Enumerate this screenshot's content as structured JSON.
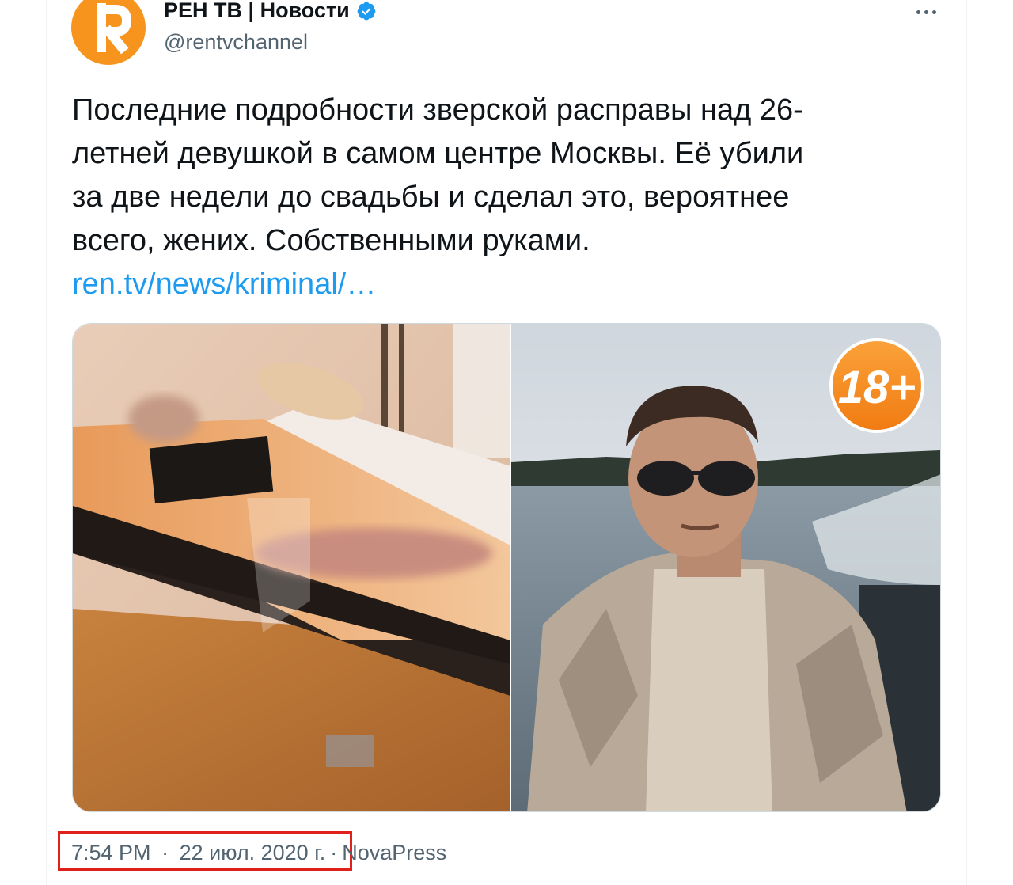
{
  "tweet": {
    "display_name": "РЕН ТВ | Новости",
    "handle": "@rentvchannel",
    "verified": true,
    "text_lines": [
      "Последние подробности зверской расправы над 26-",
      "летней девушкой в самом центре Москвы. Её убили",
      "за две недели до свадьбы и сделал это, вероятнее",
      "всего, жених. Собственными руками."
    ],
    "link_text": "ren.tv/news/kriminal/…",
    "media_badge": "18+",
    "time": "7:54 PM",
    "date": "22 июл. 2020 г.",
    "separator": "·",
    "source": "NovaPress"
  },
  "icons": {
    "avatar": "ren-tv-logo",
    "verified": "verified-badge-icon",
    "more": "more-options-icon"
  },
  "colors": {
    "brand_orange": "#f7941d",
    "link_blue": "#1d9bf0",
    "secondary_text": "#536471",
    "highlight_red": "#e0201b"
  }
}
